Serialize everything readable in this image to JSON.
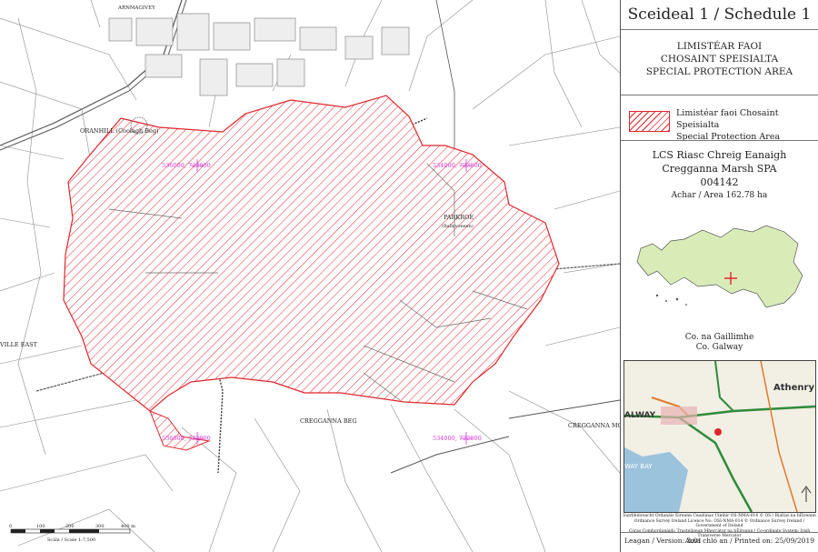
{
  "map": {
    "place_labels": [
      {
        "key": "oranhill",
        "text": "ORANHILL (Coolagh Beg)"
      },
      {
        "key": "parkroe",
        "text": "PARKROE"
      },
      {
        "key": "parkroe_sub",
        "text": "(Ballyvoneen)"
      },
      {
        "key": "ville_east",
        "text": "VILLE EAST"
      },
      {
        "key": "creggana_beg",
        "text": "CREGGANNA BEG"
      },
      {
        "key": "creggana_mor",
        "text": "CREGGANNA MO"
      },
      {
        "key": "northeast",
        "text": "ARNMAGIVEY"
      }
    ],
    "grid_labels": [
      {
        "key": "g1",
        "text": "536000, 723000"
      },
      {
        "key": "g2",
        "text": "534000, 723000"
      },
      {
        "key": "g3",
        "text": "536000, 722000"
      },
      {
        "key": "g4",
        "text": "534000, 722000"
      }
    ],
    "scale_bar": {
      "ticks": [
        "0",
        "100",
        "200",
        "300",
        "400 m"
      ],
      "caption": "Scála / Scale 1:7,500"
    }
  },
  "panel": {
    "title": "Sceideal 1 / Schedule 1",
    "heading": [
      "LIMISTÉAR FAOI",
      "CHOSAINT SPEISIALTA",
      "SPECIAL PROTECTION AREA"
    ],
    "legend": [
      "Limistéar faoi Chosaint Speisialta",
      "Special Protection Area"
    ],
    "site": {
      "name_ga": "LCS Riasc Chreig Eanaigh",
      "name_en": "Cregganna Marsh SPA",
      "code": "004142",
      "area": "Achar / Area 162.78 ha"
    },
    "county": {
      "ga": "Co. na Gaillimhe",
      "en": "Co. Galway"
    },
    "inset_labels": {
      "athenry": "Athenry",
      "galway": "ALWAY",
      "bay": "WAY BAY"
    },
    "credits": [
      "Suirbhéireacht Ordanáis Éireann Ceadúnas Uimhir OS-NMA-014 © OS / Rialtas na hÉireann",
      "Ordnance Survey Ireland Licence No. OSI-NMA-014 © Ordnance Survey Ireland / Government of Ireland",
      "Córas Comhordanáidí: Trasteilgean Mhercátor na hÉireann / Co-ordinate System: Irish Transverse Mercator"
    ],
    "version": "Leagan / Version: 3.01",
    "printed": "Ama chló an / Printed on: 25/09/2019"
  },
  "colors": {
    "spa": "#e0262c",
    "county_fill": "#d9ecb8",
    "grid_label": "#d23bd2",
    "line": "#555555"
  }
}
